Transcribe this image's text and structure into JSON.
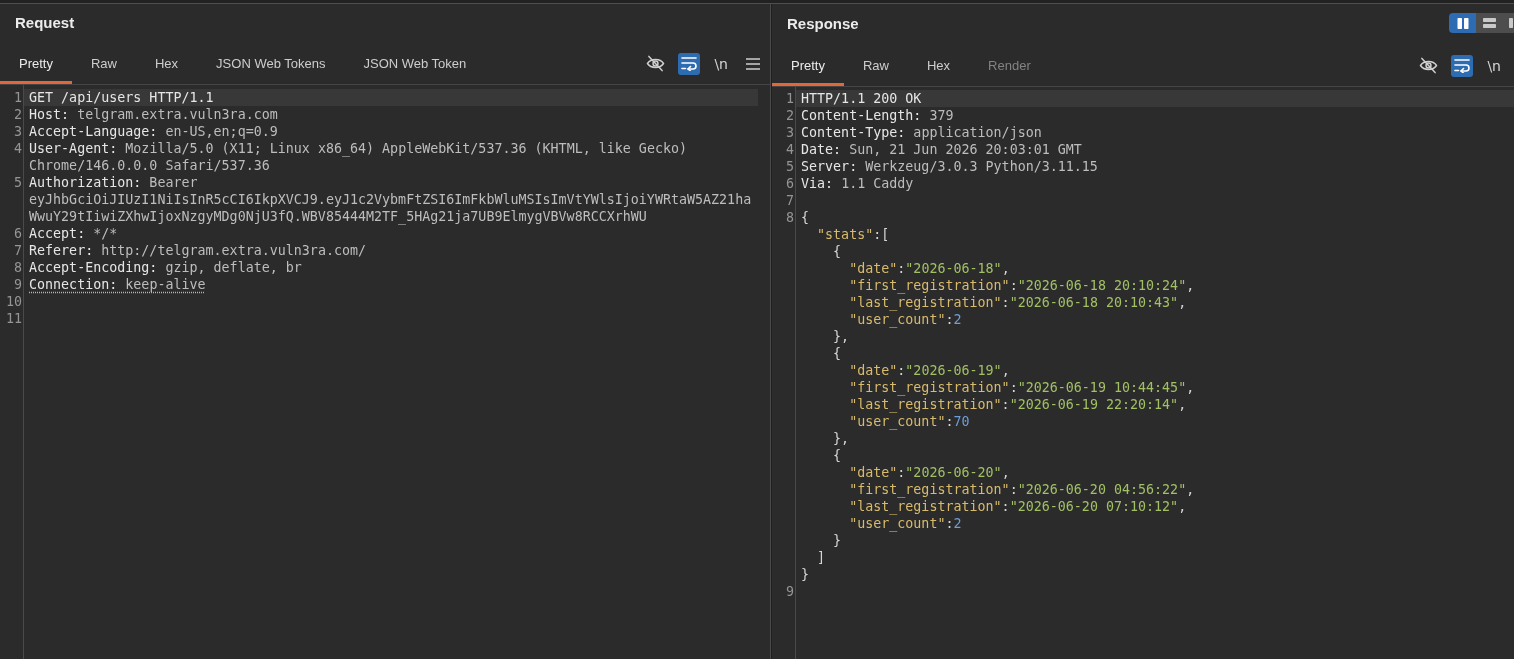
{
  "request": {
    "title": "Request",
    "tabs": [
      {
        "label": "Pretty",
        "selected": true
      },
      {
        "label": "Raw",
        "selected": false
      },
      {
        "label": "Hex",
        "selected": false
      },
      {
        "label": "JSON Web Tokens",
        "selected": false
      },
      {
        "label": "JSON Web Token",
        "selected": false
      }
    ],
    "toolbar": [
      {
        "kind": "hide",
        "on": false
      },
      {
        "kind": "wrap",
        "on": true
      },
      {
        "kind": "newline",
        "on": false,
        "label": "\\n"
      },
      {
        "kind": "menu",
        "on": false
      }
    ],
    "lines": [
      {
        "number": "1",
        "current": true,
        "dotted_underline": false,
        "tokens": [
          {
            "kind": "request_line",
            "text": "GET /api/users HTTP/1.1"
          }
        ]
      },
      {
        "number": "2",
        "current": false,
        "dotted_underline": false,
        "tokens": [
          {
            "kind": "name",
            "text": "Host:"
          },
          {
            "kind": "value",
            "text": " telgram.extra.vuln3ra.com"
          }
        ]
      },
      {
        "number": "3",
        "current": false,
        "dotted_underline": false,
        "tokens": [
          {
            "kind": "name",
            "text": "Accept-Language:"
          },
          {
            "kind": "value",
            "text": " en-US,en;q=0.9"
          }
        ]
      },
      {
        "number": "4",
        "current": false,
        "dotted_underline": false,
        "tokens": [
          {
            "kind": "name",
            "text": "User-Agent:"
          },
          {
            "kind": "value",
            "text": " Mozilla/5.0 (X11; Linux x86_64) AppleWebKit/537.36 (KHTML, like Gecko) Chrome/146.0.0.0 Safari/537.36"
          }
        ]
      },
      {
        "number": "5",
        "current": false,
        "dotted_underline": false,
        "tokens": [
          {
            "kind": "name",
            "text": "Authorization:"
          },
          {
            "kind": "value",
            "text": " Bearer eyJhbGciOiJIUzI1NiIsInR5cCI6IkpXVCJ9.eyJ1c2VybmFtZSI6ImFkbWluMSIsImVtYWlsIjoiYWRtaW5AZ21haWwuY29tIiwiZXhwIjoxNzgyMDg0NjU3fQ.WBV85444M2TF_5HAg21ja7UB9ElmygVBVw8RCCXrhWU"
          }
        ]
      },
      {
        "number": "6",
        "current": false,
        "dotted_underline": false,
        "tokens": [
          {
            "kind": "name",
            "text": "Accept:"
          },
          {
            "kind": "value",
            "text": " */*"
          }
        ]
      },
      {
        "number": "7",
        "current": false,
        "dotted_underline": false,
        "tokens": [
          {
            "kind": "name",
            "text": "Referer:"
          },
          {
            "kind": "value",
            "text": " http://telgram.extra.vuln3ra.com/"
          }
        ]
      },
      {
        "number": "8",
        "current": false,
        "dotted_underline": false,
        "tokens": [
          {
            "kind": "name",
            "text": "Accept-Encoding:"
          },
          {
            "kind": "value",
            "text": " gzip, deflate, br"
          }
        ]
      },
      {
        "number": "9",
        "current": false,
        "dotted_underline": true,
        "tokens": [
          {
            "kind": "name",
            "text": "Connection:"
          },
          {
            "kind": "value",
            "text": " keep-alive"
          }
        ]
      },
      {
        "number": "10"
      },
      {
        "number": "11"
      }
    ]
  },
  "response": {
    "title": "Response",
    "layout_buttons": [
      {
        "kind": "side_by_side",
        "selected": true
      },
      {
        "kind": "stacked",
        "selected": false
      },
      {
        "kind": "single",
        "selected": false
      }
    ],
    "tabs": [
      {
        "label": "Pretty",
        "selected": true,
        "disabled": false
      },
      {
        "label": "Raw",
        "selected": false,
        "disabled": false
      },
      {
        "label": "Hex",
        "selected": false,
        "disabled": false
      },
      {
        "label": "Render",
        "selected": false,
        "disabled": true
      }
    ],
    "toolbar": [
      {
        "kind": "hide",
        "on": false
      },
      {
        "kind": "wrap",
        "on": true
      },
      {
        "kind": "newline",
        "on": false,
        "label": "\\n"
      }
    ],
    "lines": [
      {
        "number": "1",
        "current": true,
        "tokens": [
          {
            "kind": "status_line",
            "text": "HTTP/1.1 200 OK"
          }
        ]
      },
      {
        "number": "2",
        "current": false,
        "tokens": [
          {
            "kind": "name",
            "text": "Content-Length:"
          },
          {
            "kind": "value",
            "text": " 379"
          }
        ]
      },
      {
        "number": "3",
        "current": false,
        "tokens": [
          {
            "kind": "name",
            "text": "Content-Type:"
          },
          {
            "kind": "value",
            "text": " application/json"
          }
        ]
      },
      {
        "number": "4",
        "current": false,
        "tokens": [
          {
            "kind": "name",
            "text": "Date:"
          },
          {
            "kind": "value",
            "text": " Sun, 21 Jun 2026 20:03:01 GMT"
          }
        ]
      },
      {
        "number": "5",
        "current": false,
        "tokens": [
          {
            "kind": "name",
            "text": "Server:"
          },
          {
            "kind": "value",
            "text": " Werkzeug/3.0.3 Python/3.11.15"
          }
        ]
      },
      {
        "number": "6",
        "current": false,
        "tokens": [
          {
            "kind": "name",
            "text": "Via:"
          },
          {
            "kind": "value",
            "text": " 1.1 Caddy"
          }
        ]
      },
      {
        "number": "7"
      },
      {
        "number": "8",
        "body": [
          {
            "tokens": [
              {
                "kind": "punct",
                "text": "{"
              }
            ],
            "children": [
              {
                "tokens": [
                  {
                    "kind": "key",
                    "text": "\"stats\""
                  },
                  {
                    "kind": "punct",
                    "text": ":["
                  }
                ],
                "children": [
                  {
                    "tokens": [
                      {
                        "kind": "punct",
                        "text": "{"
                      }
                    ],
                    "children": [
                      {
                        "tokens": [
                          {
                            "kind": "key",
                            "text": "\"date\""
                          },
                          {
                            "kind": "punct",
                            "text": ":"
                          },
                          {
                            "kind": "string",
                            "text": "\"2026-06-18\""
                          },
                          {
                            "kind": "punct",
                            "text": ","
                          }
                        ]
                      },
                      {
                        "tokens": [
                          {
                            "kind": "key",
                            "text": "\"first_registration\""
                          },
                          {
                            "kind": "punct",
                            "text": ":"
                          },
                          {
                            "kind": "string",
                            "text": "\"2026-06-18 20:10:24\""
                          },
                          {
                            "kind": "punct",
                            "text": ","
                          }
                        ]
                      },
                      {
                        "tokens": [
                          {
                            "kind": "key",
                            "text": "\"last_registration\""
                          },
                          {
                            "kind": "punct",
                            "text": ":"
                          },
                          {
                            "kind": "string",
                            "text": "\"2026-06-18 20:10:43\""
                          },
                          {
                            "kind": "punct",
                            "text": ","
                          }
                        ]
                      },
                      {
                        "tokens": [
                          {
                            "kind": "key",
                            "text": "\"user_count\""
                          },
                          {
                            "kind": "punct",
                            "text": ":"
                          },
                          {
                            "kind": "number",
                            "text": "2"
                          }
                        ]
                      }
                    ]
                  },
                  {
                    "tokens": [
                      {
                        "kind": "punct",
                        "text": "},"
                      }
                    ]
                  },
                  {
                    "tokens": [
                      {
                        "kind": "punct",
                        "text": "{"
                      }
                    ],
                    "children": [
                      {
                        "tokens": [
                          {
                            "kind": "key",
                            "text": "\"date\""
                          },
                          {
                            "kind": "punct",
                            "text": ":"
                          },
                          {
                            "kind": "string",
                            "text": "\"2026-06-19\""
                          },
                          {
                            "kind": "punct",
                            "text": ","
                          }
                        ]
                      },
                      {
                        "tokens": [
                          {
                            "kind": "key",
                            "text": "\"first_registration\""
                          },
                          {
                            "kind": "punct",
                            "text": ":"
                          },
                          {
                            "kind": "string",
                            "text": "\"2026-06-19 10:44:45\""
                          },
                          {
                            "kind": "punct",
                            "text": ","
                          }
                        ]
                      },
                      {
                        "tokens": [
                          {
                            "kind": "key",
                            "text": "\"last_registration\""
                          },
                          {
                            "kind": "punct",
                            "text": ":"
                          },
                          {
                            "kind": "string",
                            "text": "\"2026-06-19 22:20:14\""
                          },
                          {
                            "kind": "punct",
                            "text": ","
                          }
                        ]
                      },
                      {
                        "tokens": [
                          {
                            "kind": "key",
                            "text": "\"user_count\""
                          },
                          {
                            "kind": "punct",
                            "text": ":"
                          },
                          {
                            "kind": "number",
                            "text": "70"
                          }
                        ]
                      }
                    ]
                  },
                  {
                    "tokens": [
                      {
                        "kind": "punct",
                        "text": "},"
                      }
                    ]
                  },
                  {
                    "tokens": [
                      {
                        "kind": "punct",
                        "text": "{"
                      }
                    ],
                    "children": [
                      {
                        "tokens": [
                          {
                            "kind": "key",
                            "text": "\"date\""
                          },
                          {
                            "kind": "punct",
                            "text": ":"
                          },
                          {
                            "kind": "string",
                            "text": "\"2026-06-20\""
                          },
                          {
                            "kind": "punct",
                            "text": ","
                          }
                        ]
                      },
                      {
                        "tokens": [
                          {
                            "kind": "key",
                            "text": "\"first_registration\""
                          },
                          {
                            "kind": "punct",
                            "text": ":"
                          },
                          {
                            "kind": "string",
                            "text": "\"2026-06-20 04:56:22\""
                          },
                          {
                            "kind": "punct",
                            "text": ","
                          }
                        ]
                      },
                      {
                        "tokens": [
                          {
                            "kind": "key",
                            "text": "\"last_registration\""
                          },
                          {
                            "kind": "punct",
                            "text": ":"
                          },
                          {
                            "kind": "string",
                            "text": "\"2026-06-20 07:10:12\""
                          },
                          {
                            "kind": "punct",
                            "text": ","
                          }
                        ]
                      },
                      {
                        "tokens": [
                          {
                            "kind": "key",
                            "text": "\"user_count\""
                          },
                          {
                            "kind": "punct",
                            "text": ":"
                          },
                          {
                            "kind": "number",
                            "text": "2"
                          }
                        ]
                      }
                    ]
                  },
                  {
                    "tokens": [
                      {
                        "kind": "punct",
                        "text": "}"
                      }
                    ]
                  }
                ]
              },
              {
                "tokens": [
                  {
                    "kind": "punct",
                    "text": "]"
                  }
                ]
              }
            ]
          },
          {
            "tokens": [
              {
                "kind": "punct",
                "text": "}"
              }
            ]
          }
        ]
      },
      {
        "number": "9"
      }
    ]
  }
}
